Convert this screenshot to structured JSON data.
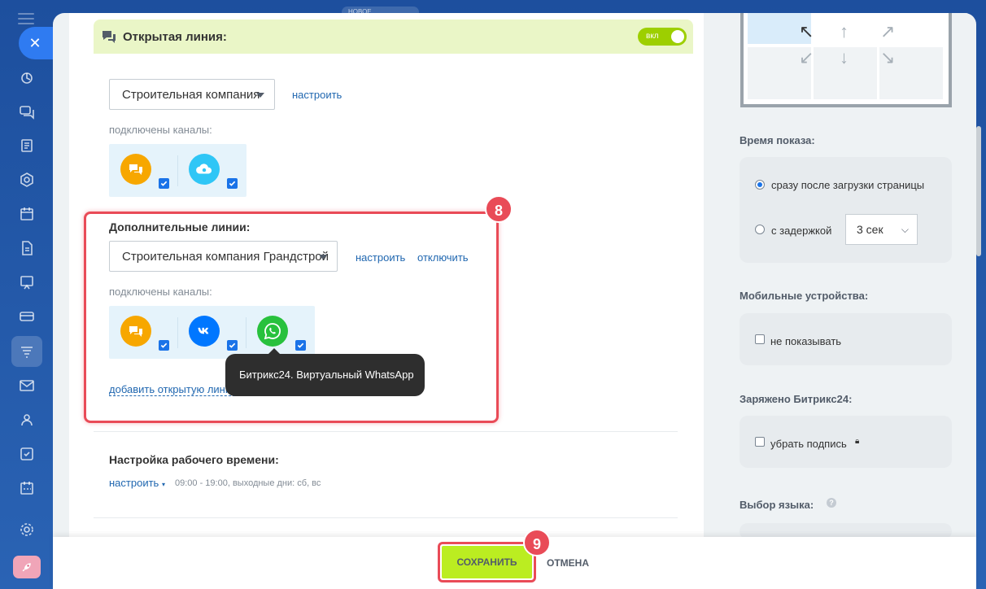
{
  "top_strip": "НОВОЕ",
  "toggle_label": "вкл",
  "open_line": {
    "title": "Открытая линия:",
    "select_value": "Строительная компания",
    "configure_link": "настроить",
    "channels_label": "подключены каналы:"
  },
  "additional_lines": {
    "title": "Дополнительные линии:",
    "select_value": "Строительная компания Грандстрой",
    "configure_link": "настроить",
    "disable_link": "отключить",
    "channels_label": "подключены каналы:",
    "add_link": "добавить открытую линию",
    "tooltip": "Битрикс24. Виртуальный WhatsApp"
  },
  "work_time": {
    "title": "Настройка рабочего времени:",
    "configure_link": "настроить",
    "schedule": "09:00 - 19:00, выходные дни: сб, вс"
  },
  "badges": {
    "b8": "8",
    "b9": "9"
  },
  "right": {
    "show_time_label": "Время показа:",
    "option_immediate": "сразу после загрузки страницы",
    "option_delay": "с задержкой",
    "delay_value": "3 сек",
    "mobile_label": "Мобильные устройства:",
    "mobile_option": "не показывать",
    "charged_label": "Заряжено Битрикс24:",
    "charged_option": "убрать подпись",
    "lang_label": "Выбор языка:"
  },
  "footer": {
    "save": "СОХРАНИТЬ",
    "cancel": "ОТМЕНА"
  }
}
